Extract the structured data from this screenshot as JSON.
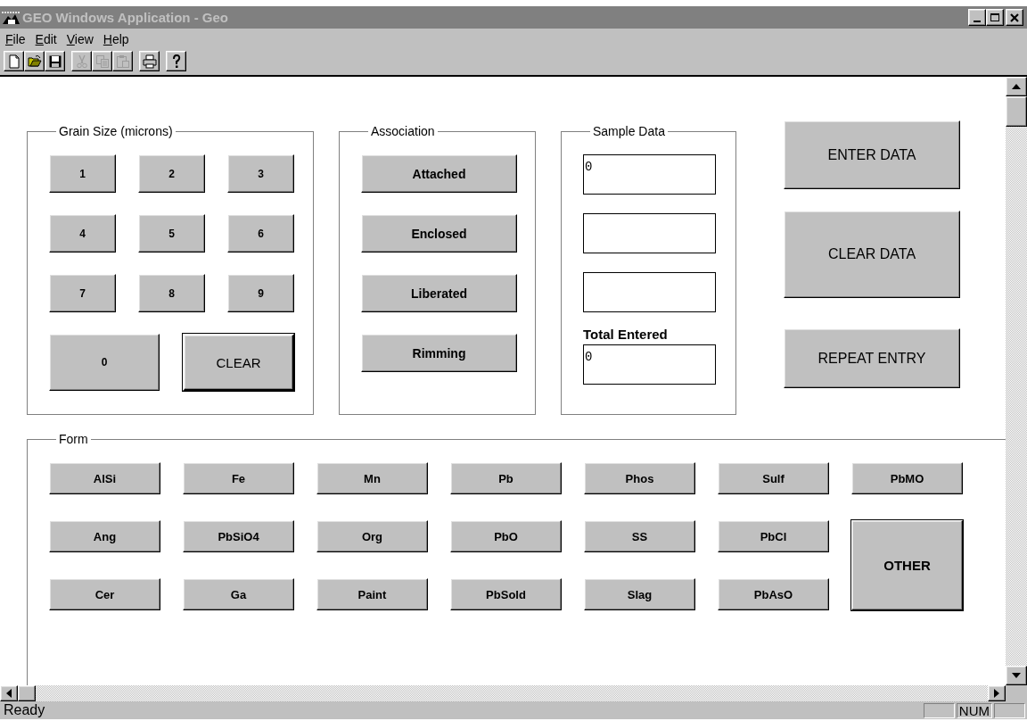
{
  "window": {
    "title": "GEO Windows Application - Geo",
    "controls": [
      {
        "kind": "minimize"
      },
      {
        "kind": "maximize"
      },
      {
        "kind": "close"
      }
    ]
  },
  "menu": [
    "File",
    "Edit",
    "View",
    "Help"
  ],
  "toolbar": [
    {
      "kind": "new",
      "disabled": false
    },
    {
      "kind": "open",
      "disabled": false
    },
    {
      "kind": "save",
      "disabled": false
    },
    {
      "kind": "cut",
      "disabled": true
    },
    {
      "kind": "copy",
      "disabled": true
    },
    {
      "kind": "paste",
      "disabled": true
    },
    {
      "kind": "print",
      "disabled": false
    },
    {
      "kind": "help",
      "disabled": false
    }
  ],
  "grain_size": {
    "title": "Grain Size (microns)",
    "keys": [
      "1",
      "2",
      "3",
      "4",
      "5",
      "6",
      "7",
      "8",
      "9",
      "0",
      "CLEAR"
    ]
  },
  "association": {
    "title": "Association",
    "buttons": [
      "Attached",
      "Enclosed",
      "Liberated",
      "Rimming"
    ]
  },
  "sample_data": {
    "title": "Sample Data",
    "fields": [
      {
        "kind": "filled",
        "value": "0"
      },
      {
        "kind": "blank"
      },
      {
        "kind": "blank"
      }
    ],
    "total_label": "Total Entered",
    "total": {
      "value": "0"
    }
  },
  "actions": [
    "ENTER DATA",
    "CLEAR DATA",
    "REPEAT ENTRY"
  ],
  "form": {
    "title": "Form",
    "buttons": [
      {
        "label": "AlSi",
        "kind": "normal"
      },
      {
        "label": "Fe",
        "kind": "normal"
      },
      {
        "label": "Mn",
        "kind": "normal"
      },
      {
        "label": "Pb",
        "kind": "normal"
      },
      {
        "label": "Phos",
        "kind": "normal"
      },
      {
        "label": "Sulf",
        "kind": "normal"
      },
      {
        "label": "PbMO",
        "kind": "normal"
      },
      {
        "label": "Ang",
        "kind": "normal"
      },
      {
        "label": "PbSiO4",
        "kind": "normal"
      },
      {
        "label": "Org",
        "kind": "normal"
      },
      {
        "label": "PbO",
        "kind": "normal"
      },
      {
        "label": "SS",
        "kind": "normal"
      },
      {
        "label": "PbCl",
        "kind": "normal"
      },
      {
        "label": "OTHER",
        "kind": "tall"
      },
      {
        "label": "Cer",
        "kind": "normal"
      },
      {
        "label": "Ga",
        "kind": "normal"
      },
      {
        "label": "Paint",
        "kind": "normal"
      },
      {
        "label": "PbSold",
        "kind": "normal"
      },
      {
        "label": "Slag",
        "kind": "normal"
      },
      {
        "label": "PbAsO",
        "kind": "normal"
      }
    ]
  },
  "status_bar": {
    "text": "Ready",
    "indicators": [
      "NUM"
    ]
  }
}
